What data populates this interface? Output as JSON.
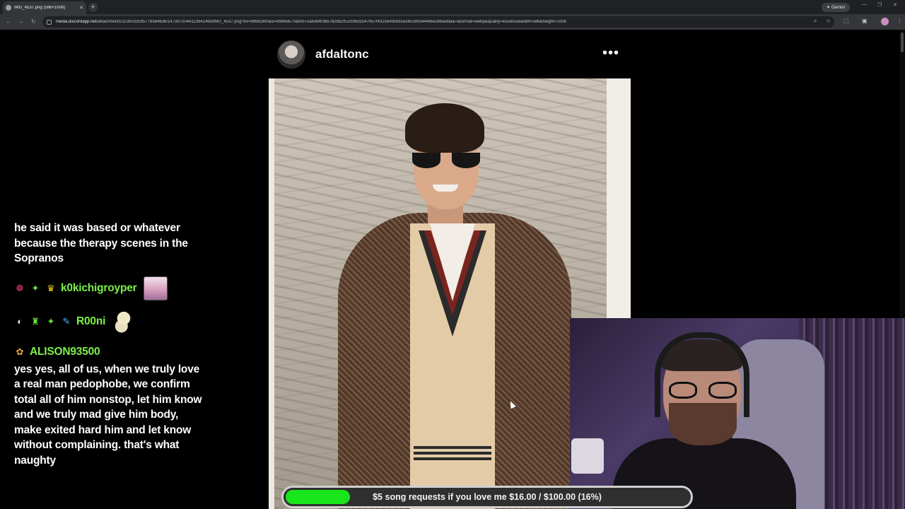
{
  "browser": {
    "tab_title": "IMG_4537.png (586×1008)",
    "tab_close": "✕",
    "new_tab": "+",
    "gemini_label": "Gemini",
    "url_host": "media.discordapp.net",
    "url_path": "/attachments/1135033595778584636/1473972044113641493/IMG_4537.png?ex=699826f0&is=6996d570&hm=2a6384f3bb7826b2f52c0f6d1547957f4315649c6b1e56cc89344486e38badda&=&format=webp&quality=lossless&width=586&height=1008"
  },
  "post": {
    "username": "afdaltonc",
    "more_label": "•••"
  },
  "chat": {
    "messages": [
      {
        "text": "he said it was based or whatever because the therapy scenes in the Sopranos"
      },
      {
        "username": "k0kichigroyper",
        "color": "#7cf04a",
        "badges": [
          "❁",
          "✦",
          "♛"
        ]
      },
      {
        "username": "R00ni",
        "color": "#7cf04a",
        "badges": [
          "◐",
          "♜",
          "✦",
          "✎"
        ]
      },
      {
        "username": "ALISON93500",
        "color": "#7cf04a",
        "badges": [
          "✿"
        ],
        "text": "yes yes, all of us, when we truly love a real man pedophobe, we confirm total all of him nonstop, let him know and we truly mad give him body, make exited hard him and let know without complaining. that's what naughty"
      }
    ]
  },
  "goal": {
    "label": "$5 song requests if you love me $16.00 / $100.00 (16%)",
    "progress": 0.16,
    "fill_color": "#19e61a"
  }
}
